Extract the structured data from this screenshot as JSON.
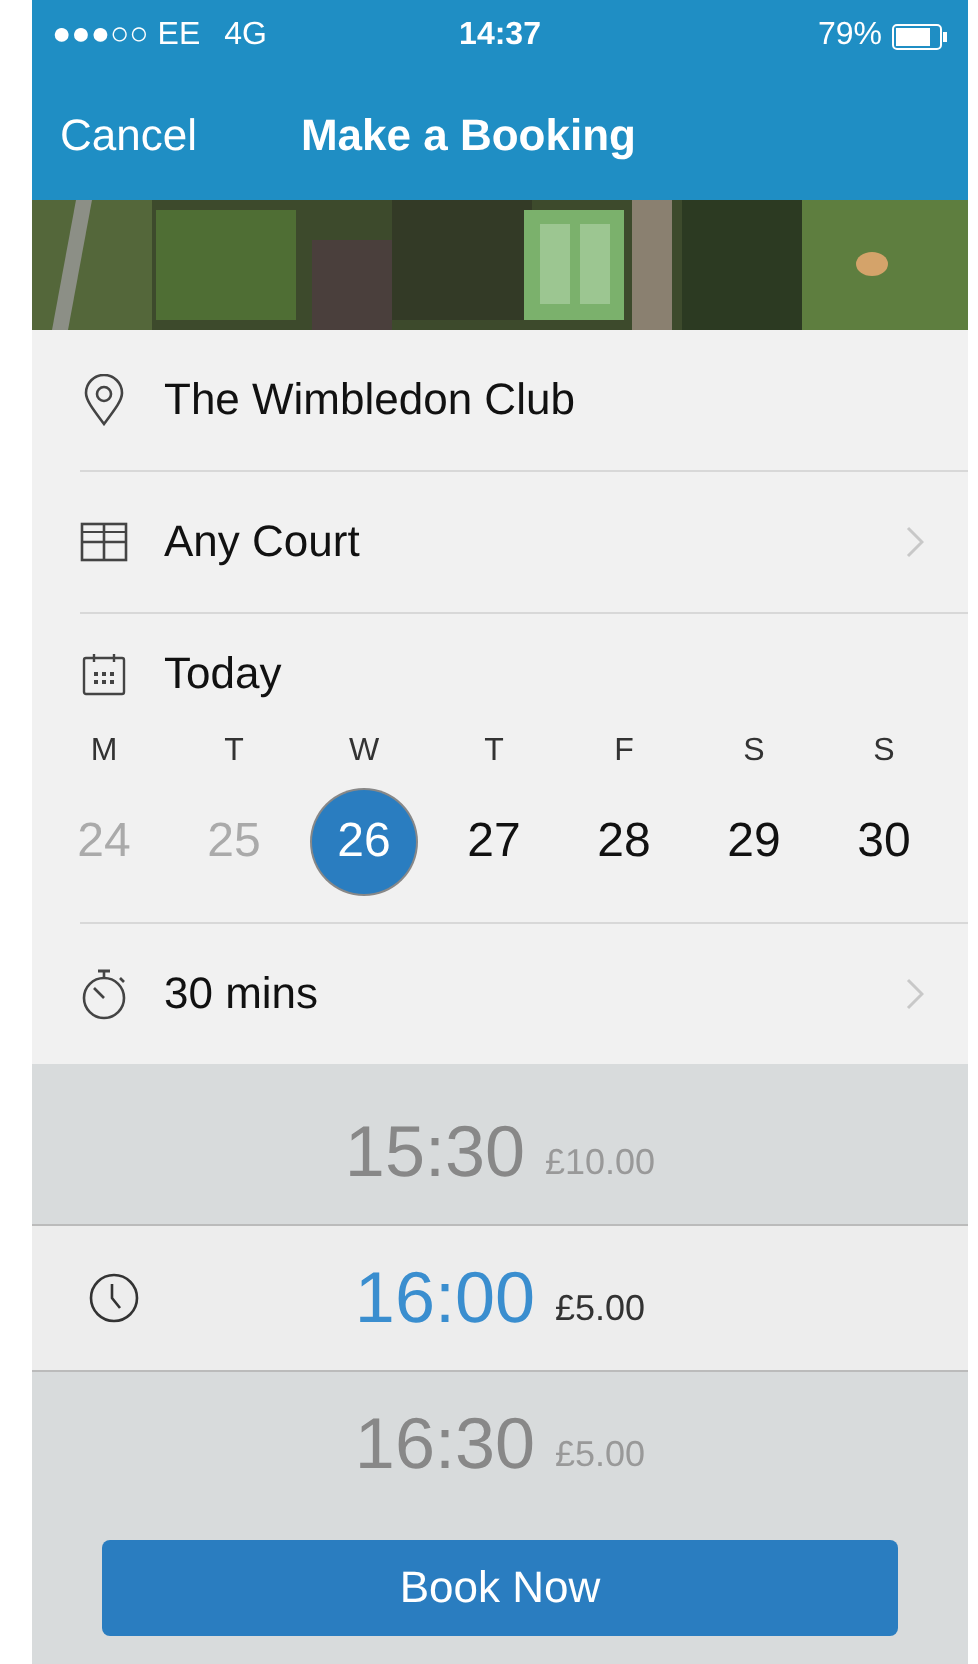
{
  "status_bar": {
    "carrier": "●●●○○ EE",
    "network": "4G",
    "time": "14:37",
    "battery": "79%"
  },
  "nav": {
    "cancel": "Cancel",
    "title": "Make a Booking"
  },
  "rows": [
    {
      "kind": "location",
      "label": "The Wimbledon Club",
      "chevron": false
    },
    {
      "kind": "court",
      "label": "Any Court",
      "chevron": true
    }
  ],
  "date": {
    "label": "Today",
    "days": [
      {
        "weekday": "M",
        "date": "24",
        "disabled": true,
        "selected": false
      },
      {
        "weekday": "T",
        "date": "25",
        "disabled": true,
        "selected": false
      },
      {
        "weekday": "W",
        "date": "26",
        "disabled": false,
        "selected": true
      },
      {
        "weekday": "T",
        "date": "27",
        "disabled": false,
        "selected": false
      },
      {
        "weekday": "F",
        "date": "28",
        "disabled": false,
        "selected": false
      },
      {
        "weekday": "S",
        "date": "29",
        "disabled": false,
        "selected": false
      },
      {
        "weekday": "S",
        "date": "30",
        "disabled": false,
        "selected": false
      }
    ]
  },
  "duration": {
    "label": "30 mins",
    "chevron": true
  },
  "slots": [
    {
      "time": "15:30",
      "price": "£10.00",
      "selected": false
    },
    {
      "time": "16:00",
      "price": "£5.00",
      "selected": true
    },
    {
      "time": "16:30",
      "price": "£5.00",
      "selected": false
    }
  ],
  "book_button": "Book Now"
}
